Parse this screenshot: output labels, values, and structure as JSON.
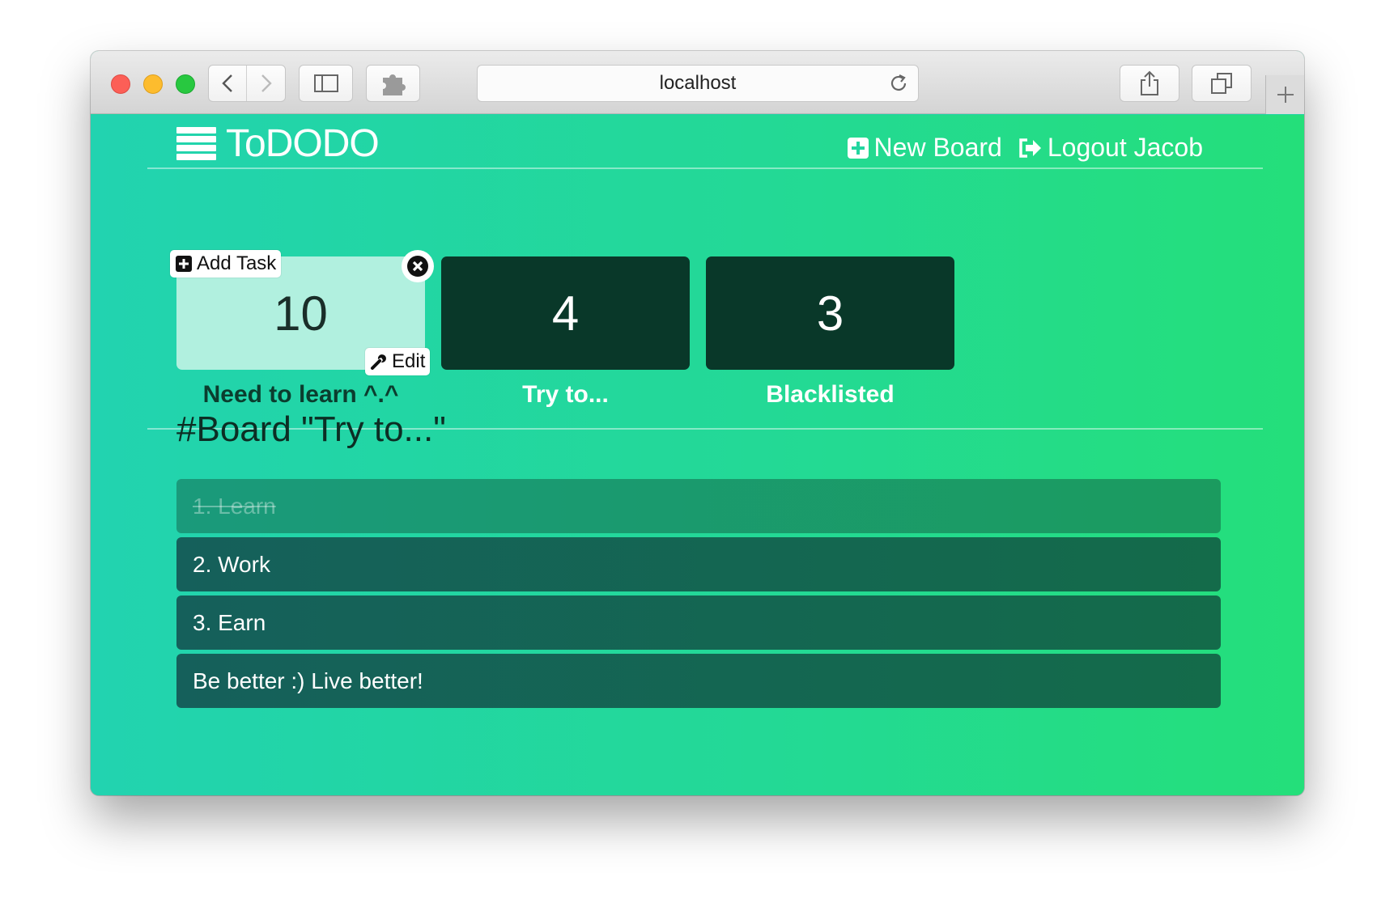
{
  "browser": {
    "url": "localhost"
  },
  "header": {
    "brand": "ToDODO",
    "new_board": "New Board",
    "logout": "Logout Jacob"
  },
  "boards": [
    {
      "count": "10",
      "label": "Need to learn ^.^",
      "active": true
    },
    {
      "count": "4",
      "label": "Try to...",
      "active": false
    },
    {
      "count": "3",
      "label": "Blacklisted",
      "active": false
    }
  ],
  "board_actions": {
    "add_task": "Add Task",
    "edit": "Edit"
  },
  "current_board": {
    "heading": "#Board \"Try to...\""
  },
  "tasks": [
    {
      "text": "1. Learn",
      "done": true
    },
    {
      "text": "2. Work",
      "done": false
    },
    {
      "text": "3. Earn",
      "done": false
    },
    {
      "text": "Be better :) Live better!",
      "done": false
    }
  ],
  "colors": {
    "bg_start": "#22d3b0",
    "bg_end": "#24df7a",
    "board_active": "#b1f0df",
    "board_dark": "#093829",
    "task": "#15605b"
  }
}
